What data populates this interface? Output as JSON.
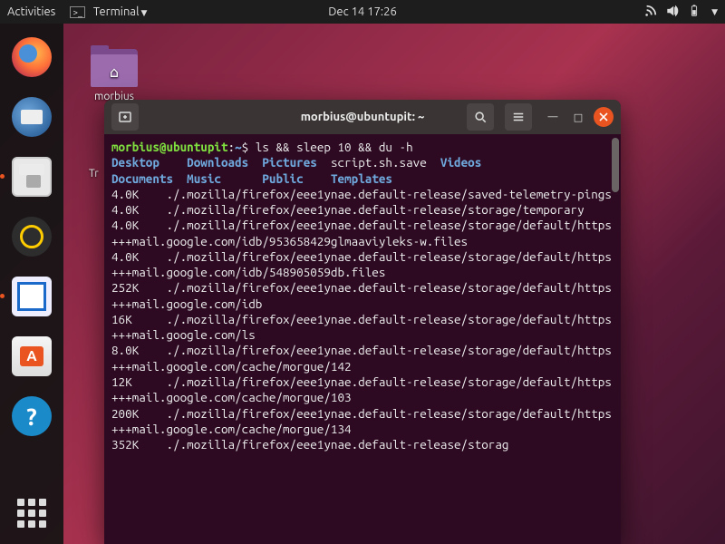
{
  "topbar": {
    "activities": "Activities",
    "app_menu": "Terminal",
    "datetime": "Dec 14  17:26"
  },
  "desktop": {
    "home_folder_label": "morbius",
    "trash_partial": "Tr"
  },
  "dock": {
    "items": [
      {
        "name": "firefox"
      },
      {
        "name": "thunderbird"
      },
      {
        "name": "files"
      },
      {
        "name": "rhythmbox"
      },
      {
        "name": "libreoffice-writer"
      },
      {
        "name": "ubuntu-software"
      },
      {
        "name": "help"
      }
    ]
  },
  "terminal": {
    "title": "morbius@ubuntupit: ~",
    "prompt": {
      "user_host": "morbius@ubuntupit",
      "sep": ":",
      "path": "~",
      "end": "$ "
    },
    "command": "ls && sleep 10 && du -h",
    "ls": {
      "row1": [
        {
          "t": "Desktop",
          "dir": true
        },
        {
          "t": "Downloads",
          "dir": true
        },
        {
          "t": "Pictures",
          "dir": true
        },
        {
          "t": "script.sh.save",
          "dir": false
        },
        {
          "t": "Videos",
          "dir": true
        }
      ],
      "row2": [
        {
          "t": "Documents",
          "dir": true
        },
        {
          "t": "Music",
          "dir": true
        },
        {
          "t": "Public",
          "dir": true
        },
        {
          "t": "Templates",
          "dir": true
        }
      ]
    },
    "du": [
      {
        "size": "4.0K",
        "path": "./.mozilla/firefox/eee1ynae.default-release/saved-telemetry-pings"
      },
      {
        "size": "4.0K",
        "path": "./.mozilla/firefox/eee1ynae.default-release/storage/temporary"
      },
      {
        "size": "4.0K",
        "path": "./.mozilla/firefox/eee1ynae.default-release/storage/default/https+++mail.google.com/idb/953658429glmaaviyleks-w.files"
      },
      {
        "size": "4.0K",
        "path": "./.mozilla/firefox/eee1ynae.default-release/storage/default/https+++mail.google.com/idb/548905059db.files"
      },
      {
        "size": "252K",
        "path": "./.mozilla/firefox/eee1ynae.default-release/storage/default/https+++mail.google.com/idb"
      },
      {
        "size": "16K",
        "path": "./.mozilla/firefox/eee1ynae.default-release/storage/default/https+++mail.google.com/ls"
      },
      {
        "size": "8.0K",
        "path": "./.mozilla/firefox/eee1ynae.default-release/storage/default/https+++mail.google.com/cache/morgue/142"
      },
      {
        "size": "12K",
        "path": "./.mozilla/firefox/eee1ynae.default-release/storage/default/https+++mail.google.com/cache/morgue/103"
      },
      {
        "size": "200K",
        "path": "./.mozilla/firefox/eee1ynae.default-release/storage/default/https+++mail.google.com/cache/morgue/134"
      },
      {
        "size": "352K",
        "path": "./.mozilla/firefox/eee1ynae.default-release/storag"
      }
    ]
  }
}
